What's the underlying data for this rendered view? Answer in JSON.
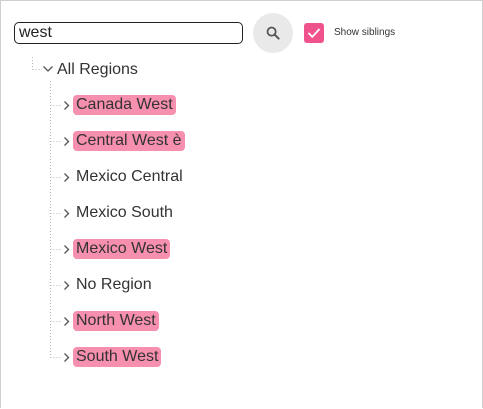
{
  "search": {
    "value": "west"
  },
  "search_button": {
    "icon": "search-icon"
  },
  "show_siblings": {
    "label": "Show siblings",
    "checked": true,
    "color": "#f0528b"
  },
  "tree": {
    "root": {
      "label": "All Regions",
      "expanded": true
    },
    "highlight_color": "#f78fae",
    "items": [
      {
        "label": "Canada West",
        "highlighted": true
      },
      {
        "label": "Central West è",
        "highlighted": true
      },
      {
        "label": "Mexico Central",
        "highlighted": false
      },
      {
        "label": "Mexico South",
        "highlighted": false
      },
      {
        "label": "Mexico West",
        "highlighted": true
      },
      {
        "label": "No Region",
        "highlighted": false
      },
      {
        "label": "North West",
        "highlighted": true
      },
      {
        "label": "South West",
        "highlighted": true
      }
    ]
  }
}
